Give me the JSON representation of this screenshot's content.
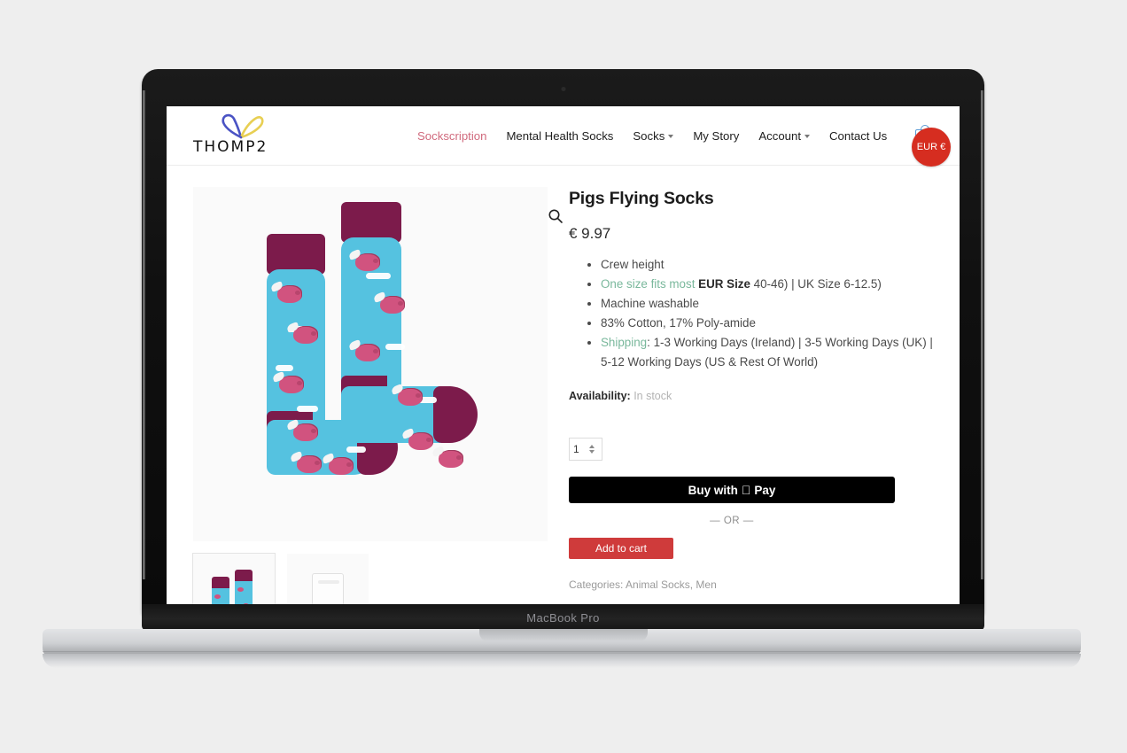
{
  "device": {
    "model_label": "MacBook Pro"
  },
  "site": {
    "logo": {
      "wordmark": "THOMP2",
      "heart_left_color": "#4a53c4",
      "heart_right_color": "#e8cf53"
    },
    "nav": [
      {
        "label": "Sockscription",
        "active": true,
        "has_dropdown": false
      },
      {
        "label": "Mental Health Socks",
        "active": false,
        "has_dropdown": false
      },
      {
        "label": "Socks",
        "active": false,
        "has_dropdown": true
      },
      {
        "label": "My Story",
        "active": false,
        "has_dropdown": false
      },
      {
        "label": "Account",
        "active": false,
        "has_dropdown": true
      },
      {
        "label": "Contact Us",
        "active": false,
        "has_dropdown": false
      }
    ],
    "cart": {
      "count": "0"
    },
    "currency": {
      "label": "EUR €",
      "color": "#d62d20"
    }
  },
  "product": {
    "title": "Pigs Flying Socks",
    "price": "€ 9.97",
    "features": [
      {
        "text": "Crew height"
      },
      {
        "highlight": "One size fits most",
        "bold": " EUR Size ",
        "rest": "40-46) | UK Size 6-12.5)"
      },
      {
        "text": "Machine washable"
      },
      {
        "text": "83% Cotton, 17% Poly-amide"
      },
      {
        "highlight": "Shipping",
        "rest": ": 1-3 Working Days (Ireland) | 3-5 Working Days (UK) | 5-12 Working Days (US & Rest Of World)"
      }
    ],
    "availability_label": "Availability:",
    "availability_value": "In stock",
    "quantity": "1",
    "apple_pay_label": "Buy with",
    "apple_pay_suffix": "Pay",
    "or_label": "— OR —",
    "add_to_cart_label": "Add to cart",
    "categories": "Categories: Animal Socks, Men",
    "gallery": {
      "zoom_icon": "magnifier-icon",
      "thumbnails": [
        {
          "name": "socks-thumbnail"
        },
        {
          "name": "packaging-thumbnail"
        }
      ]
    }
  },
  "colors": {
    "accent_pink": "#d06a7d",
    "highlight_green": "#7ab89c",
    "add_to_cart_red": "#cf3b3b",
    "sock_blue": "#55c2e0",
    "sock_maroon": "#7c1b4b"
  }
}
